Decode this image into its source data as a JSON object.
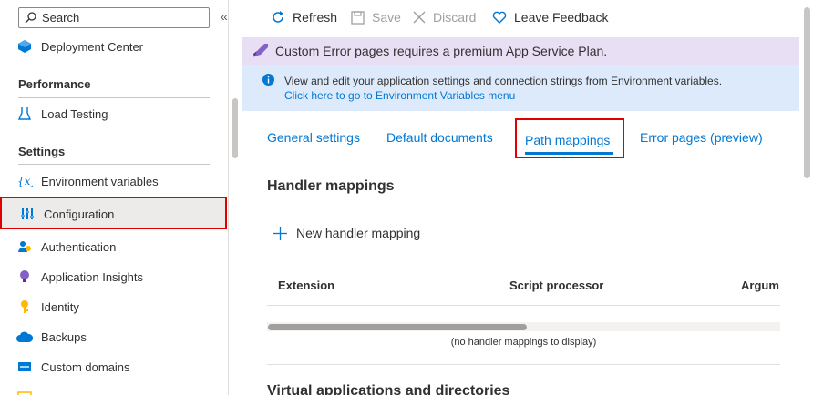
{
  "sidebar": {
    "search_placeholder": "Search",
    "collapse_glyph": "«",
    "items": [
      {
        "label": "Deployment Center",
        "icon": "deployment-center-icon"
      },
      {
        "label": "Load Testing",
        "icon": "load-testing-icon"
      },
      {
        "label": "Environment variables",
        "icon": "environment-variables-icon"
      },
      {
        "label": "Configuration",
        "icon": "configuration-icon",
        "selected": true
      },
      {
        "label": "Authentication",
        "icon": "authentication-icon"
      },
      {
        "label": "Application Insights",
        "icon": "application-insights-icon"
      },
      {
        "label": "Identity",
        "icon": "identity-icon"
      },
      {
        "label": "Backups",
        "icon": "backups-icon"
      },
      {
        "label": "Custom domains",
        "icon": "custom-domains-icon"
      }
    ],
    "sections": {
      "performance": "Performance",
      "settings": "Settings"
    }
  },
  "toolbar": {
    "refresh": "Refresh",
    "save": "Save",
    "discard": "Discard",
    "feedback": "Leave Feedback"
  },
  "banners": {
    "premium": "Custom Error pages requires a premium App Service Plan.",
    "info_text": "View and edit your application settings and connection strings from Environment variables.",
    "info_link": "Click here to go to Environment Variables menu"
  },
  "tabs": [
    "General settings",
    "Default documents",
    "Path mappings",
    "Error pages (preview)"
  ],
  "active_tab": "Path mappings",
  "content": {
    "handler_title": "Handler mappings",
    "new_handler": "New handler mapping",
    "columns": [
      "Extension",
      "Script processor",
      "Argum"
    ],
    "empty_text": "(no handler mappings to display)",
    "virtual_title": "Virtual applications and directories"
  },
  "colors": {
    "accent": "#0078d4",
    "highlight": "#e00000",
    "premium_bg": "#e8dff5",
    "info_bg": "#ddeafc"
  }
}
